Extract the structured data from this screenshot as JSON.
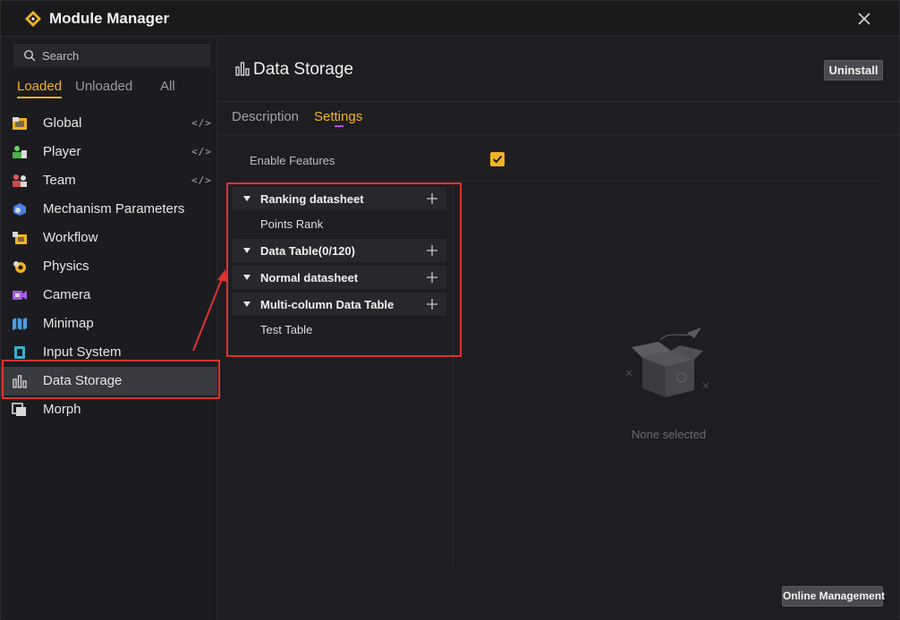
{
  "window": {
    "title": "Module Manager"
  },
  "search": {
    "placeholder": "Search"
  },
  "filter_tabs": [
    "Loaded",
    "Unloaded",
    "All"
  ],
  "modules": [
    {
      "label": "Global",
      "icon": "global-icon",
      "code": "</>"
    },
    {
      "label": "Player",
      "icon": "player-icon",
      "code": "</>"
    },
    {
      "label": "Team",
      "icon": "team-icon",
      "code": "</>"
    },
    {
      "label": "Mechanism Parameters",
      "icon": "mechanism-icon"
    },
    {
      "label": "Workflow",
      "icon": "workflow-icon"
    },
    {
      "label": "Physics",
      "icon": "physics-icon"
    },
    {
      "label": "Camera",
      "icon": "camera-icon"
    },
    {
      "label": "Minimap",
      "icon": "minimap-icon"
    },
    {
      "label": "Input System",
      "icon": "input-system-icon"
    },
    {
      "label": "Data Storage",
      "icon": "data-storage-icon",
      "active": true
    },
    {
      "label": "Morph",
      "icon": "morph-icon"
    }
  ],
  "main": {
    "title": "Data Storage",
    "uninstall_label": "Uninstall",
    "tabs": [
      "Description",
      "Settings"
    ],
    "active_tab": "Settings",
    "enable_features_label": "Enable Features",
    "enable_features_checked": true,
    "tree": {
      "groups": [
        {
          "label": "Ranking datasheet",
          "children": [
            "Points Rank"
          ]
        },
        {
          "label": "Data Table(0/120)",
          "children": []
        },
        {
          "label": "Normal datasheet",
          "children": []
        },
        {
          "label": "Multi-column Data Table",
          "children": [
            "Test Table"
          ]
        }
      ]
    },
    "empty_text": "None selected",
    "online_label": "Online Management"
  },
  "colors": {
    "accent": "#f0b422",
    "highlight": "#e0322e",
    "tab_indicator": "#b44ae0"
  }
}
